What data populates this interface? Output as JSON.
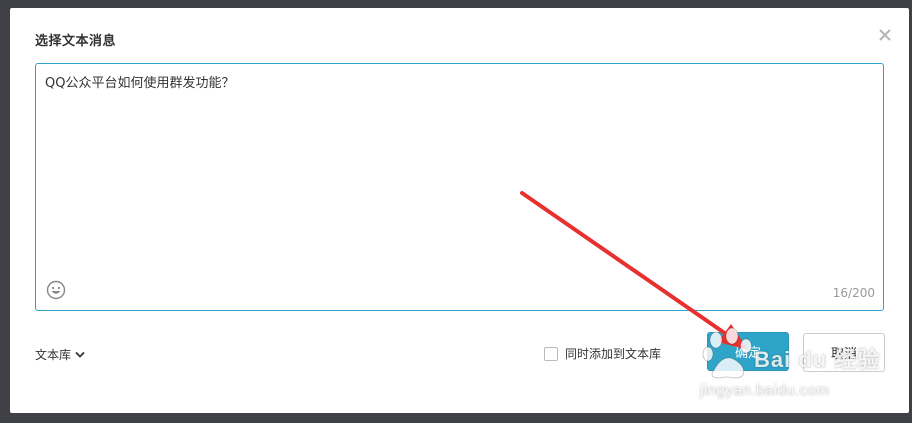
{
  "dialog": {
    "title": "选择文本消息",
    "close_icon": "close-icon"
  },
  "editor": {
    "text": "QQ公众平台如何使用群发功能？",
    "char_count": "16/200",
    "emoji_icon": "emoji-smiley-icon",
    "border_color": "#2fa4c9"
  },
  "footer": {
    "library_label": "文本库",
    "library_icon": "chevron-down-icon",
    "sync_label": "同时添加到文本库",
    "sync_checked": false,
    "confirm_label": "确定",
    "cancel_label": "取消",
    "accent_color": "#2fa4c9"
  },
  "annotation": {
    "arrow_color": "#e8302e"
  },
  "watermark": {
    "brand": "Bai du 经验",
    "url": "jingyan.baidu.com"
  }
}
